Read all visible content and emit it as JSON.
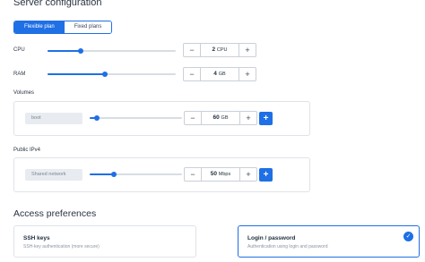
{
  "header": {
    "title": "Server configuration"
  },
  "plan_tabs": [
    {
      "label": "Flexible plan",
      "active": true
    },
    {
      "label": "Fixed plans",
      "active": false
    }
  ],
  "cpu": {
    "label": "CPU",
    "value": "2",
    "unit": "CPU",
    "level": 0.26,
    "minus": "−",
    "plus": "+"
  },
  "ram": {
    "label": "RAM",
    "value": "4",
    "unit": "GB",
    "level": 0.45,
    "minus": "−",
    "plus": "+"
  },
  "volumes": {
    "label": "Volumes",
    "pill": "boot",
    "value": "60",
    "unit": "GB",
    "level": 0.08,
    "minus": "−",
    "plus": "+",
    "add": "+"
  },
  "ipv4": {
    "label": "Public IPv4",
    "pill": "Shared network",
    "value": "50",
    "unit": "Mbps",
    "level": 0.26,
    "minus": "−",
    "plus": "+",
    "add": "+"
  },
  "access": {
    "title": "Access preferences",
    "options": [
      {
        "title": "SSH keys",
        "desc": "SSH-key authentication (more secure)",
        "selected": false
      },
      {
        "title": "Login / password",
        "desc": "Authentication using login and password",
        "selected": true
      }
    ],
    "check_icon": "✓"
  },
  "colors": {
    "accent": "#1f6fe5",
    "track": "#d8dde3",
    "border": "#dfe3e8"
  }
}
